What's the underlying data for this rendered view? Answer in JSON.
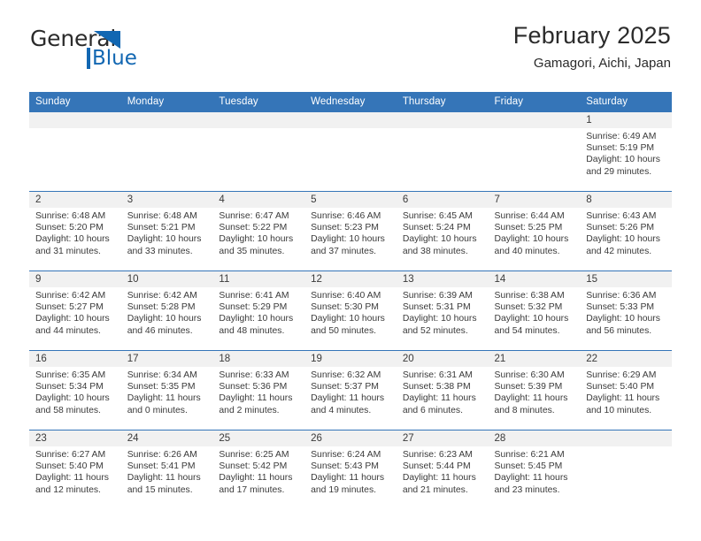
{
  "brand": {
    "name_top": "General",
    "name_bottom": "Blue",
    "accent_color": "#1267b2"
  },
  "header": {
    "title": "February 2025",
    "subtitle": "Gamagori, Aichi, Japan"
  },
  "theme": {
    "header_blue": "#3575b8",
    "daynum_band": "#f1f1f1",
    "text": "#3a3a3a"
  },
  "weekday_headers": [
    "Sunday",
    "Monday",
    "Tuesday",
    "Wednesday",
    "Thursday",
    "Friday",
    "Saturday"
  ],
  "labels": {
    "sunrise": "Sunrise:",
    "sunset": "Sunset:",
    "daylight": "Daylight:"
  },
  "weeks": [
    [
      {
        "day": "",
        "sunrise": "",
        "sunset": "",
        "daylight_line1": "",
        "daylight_line2": ""
      },
      {
        "day": "",
        "sunrise": "",
        "sunset": "",
        "daylight_line1": "",
        "daylight_line2": ""
      },
      {
        "day": "",
        "sunrise": "",
        "sunset": "",
        "daylight_line1": "",
        "daylight_line2": ""
      },
      {
        "day": "",
        "sunrise": "",
        "sunset": "",
        "daylight_line1": "",
        "daylight_line2": ""
      },
      {
        "day": "",
        "sunrise": "",
        "sunset": "",
        "daylight_line1": "",
        "daylight_line2": ""
      },
      {
        "day": "",
        "sunrise": "",
        "sunset": "",
        "daylight_line1": "",
        "daylight_line2": ""
      },
      {
        "day": "1",
        "sunrise": "Sunrise: 6:49 AM",
        "sunset": "Sunset: 5:19 PM",
        "daylight_line1": "Daylight: 10 hours",
        "daylight_line2": "and 29 minutes."
      }
    ],
    [
      {
        "day": "2",
        "sunrise": "Sunrise: 6:48 AM",
        "sunset": "Sunset: 5:20 PM",
        "daylight_line1": "Daylight: 10 hours",
        "daylight_line2": "and 31 minutes."
      },
      {
        "day": "3",
        "sunrise": "Sunrise: 6:48 AM",
        "sunset": "Sunset: 5:21 PM",
        "daylight_line1": "Daylight: 10 hours",
        "daylight_line2": "and 33 minutes."
      },
      {
        "day": "4",
        "sunrise": "Sunrise: 6:47 AM",
        "sunset": "Sunset: 5:22 PM",
        "daylight_line1": "Daylight: 10 hours",
        "daylight_line2": "and 35 minutes."
      },
      {
        "day": "5",
        "sunrise": "Sunrise: 6:46 AM",
        "sunset": "Sunset: 5:23 PM",
        "daylight_line1": "Daylight: 10 hours",
        "daylight_line2": "and 37 minutes."
      },
      {
        "day": "6",
        "sunrise": "Sunrise: 6:45 AM",
        "sunset": "Sunset: 5:24 PM",
        "daylight_line1": "Daylight: 10 hours",
        "daylight_line2": "and 38 minutes."
      },
      {
        "day": "7",
        "sunrise": "Sunrise: 6:44 AM",
        "sunset": "Sunset: 5:25 PM",
        "daylight_line1": "Daylight: 10 hours",
        "daylight_line2": "and 40 minutes."
      },
      {
        "day": "8",
        "sunrise": "Sunrise: 6:43 AM",
        "sunset": "Sunset: 5:26 PM",
        "daylight_line1": "Daylight: 10 hours",
        "daylight_line2": "and 42 minutes."
      }
    ],
    [
      {
        "day": "9",
        "sunrise": "Sunrise: 6:42 AM",
        "sunset": "Sunset: 5:27 PM",
        "daylight_line1": "Daylight: 10 hours",
        "daylight_line2": "and 44 minutes."
      },
      {
        "day": "10",
        "sunrise": "Sunrise: 6:42 AM",
        "sunset": "Sunset: 5:28 PM",
        "daylight_line1": "Daylight: 10 hours",
        "daylight_line2": "and 46 minutes."
      },
      {
        "day": "11",
        "sunrise": "Sunrise: 6:41 AM",
        "sunset": "Sunset: 5:29 PM",
        "daylight_line1": "Daylight: 10 hours",
        "daylight_line2": "and 48 minutes."
      },
      {
        "day": "12",
        "sunrise": "Sunrise: 6:40 AM",
        "sunset": "Sunset: 5:30 PM",
        "daylight_line1": "Daylight: 10 hours",
        "daylight_line2": "and 50 minutes."
      },
      {
        "day": "13",
        "sunrise": "Sunrise: 6:39 AM",
        "sunset": "Sunset: 5:31 PM",
        "daylight_line1": "Daylight: 10 hours",
        "daylight_line2": "and 52 minutes."
      },
      {
        "day": "14",
        "sunrise": "Sunrise: 6:38 AM",
        "sunset": "Sunset: 5:32 PM",
        "daylight_line1": "Daylight: 10 hours",
        "daylight_line2": "and 54 minutes."
      },
      {
        "day": "15",
        "sunrise": "Sunrise: 6:36 AM",
        "sunset": "Sunset: 5:33 PM",
        "daylight_line1": "Daylight: 10 hours",
        "daylight_line2": "and 56 minutes."
      }
    ],
    [
      {
        "day": "16",
        "sunrise": "Sunrise: 6:35 AM",
        "sunset": "Sunset: 5:34 PM",
        "daylight_line1": "Daylight: 10 hours",
        "daylight_line2": "and 58 minutes."
      },
      {
        "day": "17",
        "sunrise": "Sunrise: 6:34 AM",
        "sunset": "Sunset: 5:35 PM",
        "daylight_line1": "Daylight: 11 hours",
        "daylight_line2": "and 0 minutes."
      },
      {
        "day": "18",
        "sunrise": "Sunrise: 6:33 AM",
        "sunset": "Sunset: 5:36 PM",
        "daylight_line1": "Daylight: 11 hours",
        "daylight_line2": "and 2 minutes."
      },
      {
        "day": "19",
        "sunrise": "Sunrise: 6:32 AM",
        "sunset": "Sunset: 5:37 PM",
        "daylight_line1": "Daylight: 11 hours",
        "daylight_line2": "and 4 minutes."
      },
      {
        "day": "20",
        "sunrise": "Sunrise: 6:31 AM",
        "sunset": "Sunset: 5:38 PM",
        "daylight_line1": "Daylight: 11 hours",
        "daylight_line2": "and 6 minutes."
      },
      {
        "day": "21",
        "sunrise": "Sunrise: 6:30 AM",
        "sunset": "Sunset: 5:39 PM",
        "daylight_line1": "Daylight: 11 hours",
        "daylight_line2": "and 8 minutes."
      },
      {
        "day": "22",
        "sunrise": "Sunrise: 6:29 AM",
        "sunset": "Sunset: 5:40 PM",
        "daylight_line1": "Daylight: 11 hours",
        "daylight_line2": "and 10 minutes."
      }
    ],
    [
      {
        "day": "23",
        "sunrise": "Sunrise: 6:27 AM",
        "sunset": "Sunset: 5:40 PM",
        "daylight_line1": "Daylight: 11 hours",
        "daylight_line2": "and 12 minutes."
      },
      {
        "day": "24",
        "sunrise": "Sunrise: 6:26 AM",
        "sunset": "Sunset: 5:41 PM",
        "daylight_line1": "Daylight: 11 hours",
        "daylight_line2": "and 15 minutes."
      },
      {
        "day": "25",
        "sunrise": "Sunrise: 6:25 AM",
        "sunset": "Sunset: 5:42 PM",
        "daylight_line1": "Daylight: 11 hours",
        "daylight_line2": "and 17 minutes."
      },
      {
        "day": "26",
        "sunrise": "Sunrise: 6:24 AM",
        "sunset": "Sunset: 5:43 PM",
        "daylight_line1": "Daylight: 11 hours",
        "daylight_line2": "and 19 minutes."
      },
      {
        "day": "27",
        "sunrise": "Sunrise: 6:23 AM",
        "sunset": "Sunset: 5:44 PM",
        "daylight_line1": "Daylight: 11 hours",
        "daylight_line2": "and 21 minutes."
      },
      {
        "day": "28",
        "sunrise": "Sunrise: 6:21 AM",
        "sunset": "Sunset: 5:45 PM",
        "daylight_line1": "Daylight: 11 hours",
        "daylight_line2": "and 23 minutes."
      },
      {
        "day": "",
        "sunrise": "",
        "sunset": "",
        "daylight_line1": "",
        "daylight_line2": ""
      }
    ]
  ]
}
